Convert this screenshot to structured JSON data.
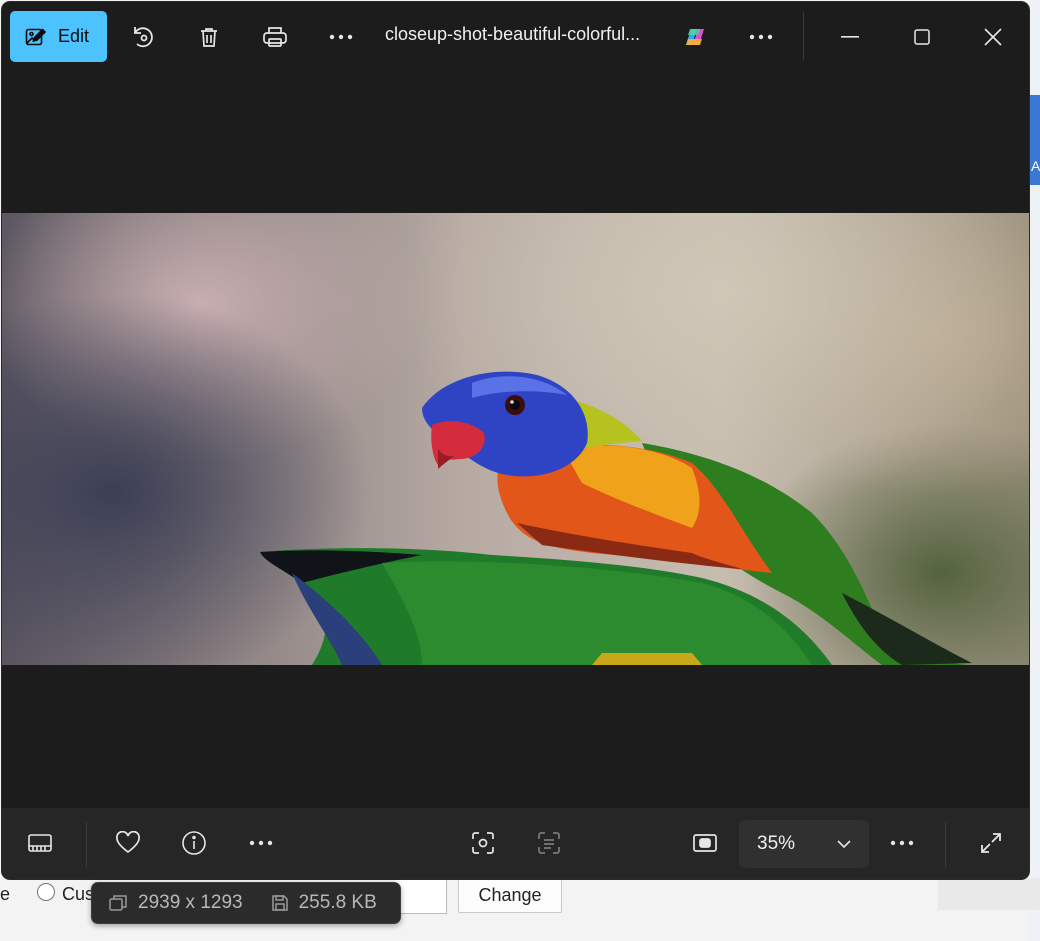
{
  "viewer": {
    "edit_label": "Edit",
    "file_title": "closeup-shot-beautiful-colorful...",
    "zoom_level": "35%"
  },
  "image_info": {
    "dimensions": "2939 x 1293",
    "file_size": "255.8 KB"
  },
  "background_app": {
    "partial_letter_left": "e",
    "radio_label_partial": "Cus",
    "change_button_label": "Change",
    "blue_strip_letter": "A"
  },
  "icons": {
    "edit": "image-edit-icon",
    "rotate": "rotate-icon",
    "delete": "trash-icon",
    "print": "print-icon",
    "more": "more-icon",
    "copilot": "copilot-icon",
    "minimize": "minimize-icon",
    "maximize": "maximize-icon",
    "close": "close-icon",
    "filmstrip": "filmstrip-icon",
    "favorite": "heart-icon",
    "info": "info-icon",
    "visual_search": "visual-search-icon",
    "text_scan": "text-scan-icon",
    "fit": "fit-to-window-icon",
    "chevron": "chevron-down-icon",
    "fullscreen": "fullscreen-icon",
    "dimensions": "dimensions-icon",
    "disk": "disk-icon"
  },
  "colors": {
    "accent": "#4cc2ff",
    "window_bg": "#1c1c1c",
    "toolbar_bg": "#262626"
  }
}
